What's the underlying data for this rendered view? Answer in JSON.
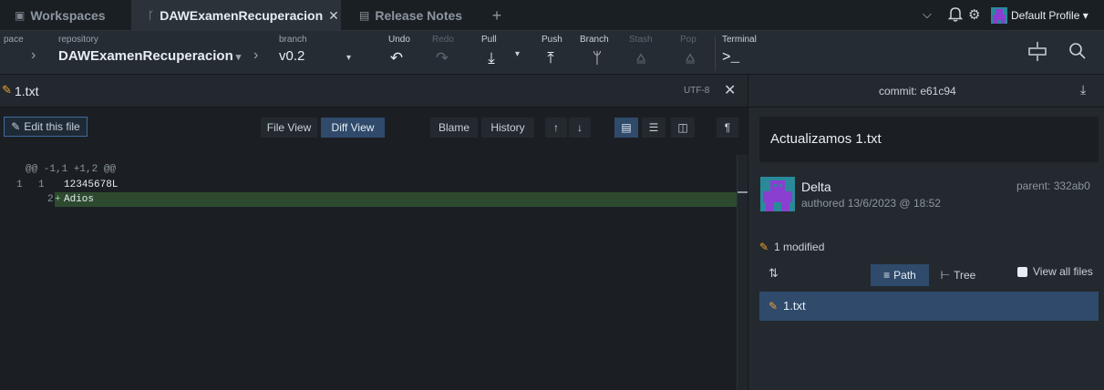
{
  "tabs": {
    "workspaces": "Workspaces",
    "repo_tab": "DAWExamenRecuperacion",
    "release_notes": "Release Notes",
    "add": "+",
    "profile": "Default Profile"
  },
  "toolbar": {
    "workspace_label": "pace",
    "repository_label": "repository",
    "repository_name": "DAWExamenRecuperacion",
    "branch_label": "branch",
    "branch_name": "v0.2",
    "undo": "Undo",
    "redo": "Redo",
    "pull": "Pull",
    "push": "Push",
    "branch": "Branch",
    "stash": "Stash",
    "pop": "Pop",
    "terminal": "Terminal"
  },
  "file": {
    "name": "1.txt",
    "encoding": "UTF-8",
    "edit_button": "Edit this file",
    "file_view": "File View",
    "diff_view": "Diff View",
    "blame": "Blame",
    "history": "History"
  },
  "diff": {
    "hunk_header": "@@ -1,1 +1,2 @@",
    "lines": [
      {
        "old": "1",
        "new": "1",
        "sign": "",
        "text": "12345678L",
        "type": "context"
      },
      {
        "old": "",
        "new": "2",
        "sign": "+",
        "text": "Adios",
        "type": "added"
      }
    ]
  },
  "commit": {
    "header": "commit: e61c94",
    "message": "Actualizamos 1.txt",
    "author": "Delta",
    "authored": "authored 13/6/2023 @ 18:52",
    "parent": "parent: 332ab0",
    "modified": "1 modified",
    "path_btn": "Path",
    "tree_btn": "Tree",
    "view_all": "View all files",
    "files": [
      "1.txt"
    ]
  },
  "colors": {
    "accent": "#2f4a6b",
    "added_bg": "#2d4a2f",
    "edit_pencil": "#f0a030",
    "avatar": "#8a3fd0"
  }
}
